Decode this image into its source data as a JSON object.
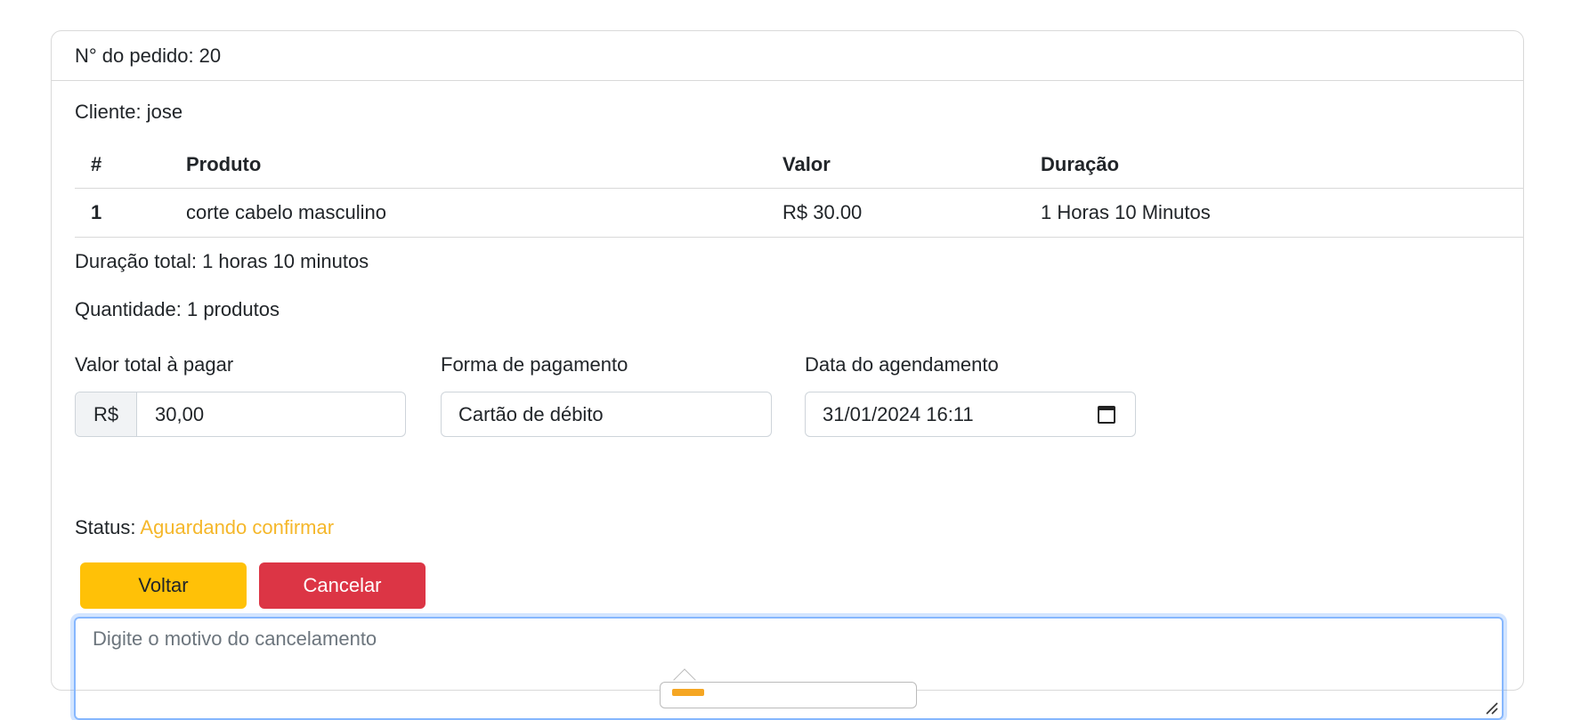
{
  "order": {
    "header": "N° do pedido: 20",
    "client": "Cliente: jose"
  },
  "table": {
    "headers": [
      "#",
      "Produto",
      "Valor",
      "Duração"
    ],
    "rows": [
      [
        "1",
        "corte cabelo masculino",
        "R$ 30.00",
        "1 Horas 10 Minutos"
      ]
    ]
  },
  "summary": {
    "duration_total": "Duração total: 1 horas 10 minutos",
    "quantity": "Quantidade: 1 produtos"
  },
  "fields": {
    "total_label": "Valor total à pagar",
    "total_prefix": "R$",
    "total_value": "30,00",
    "payment_label": "Forma de pagamento",
    "payment_value": "Cartão de débito",
    "date_label": "Data do agendamento",
    "date_value": "31/01/2024 16:11"
  },
  "status": {
    "label": "Status:",
    "value": "Aguardando confirmar",
    "color": "#f5b72a"
  },
  "buttons": {
    "back": "Voltar",
    "cancel": "Cancelar"
  },
  "cancel_reason": {
    "placeholder": "Digite o motivo do cancelamento"
  }
}
